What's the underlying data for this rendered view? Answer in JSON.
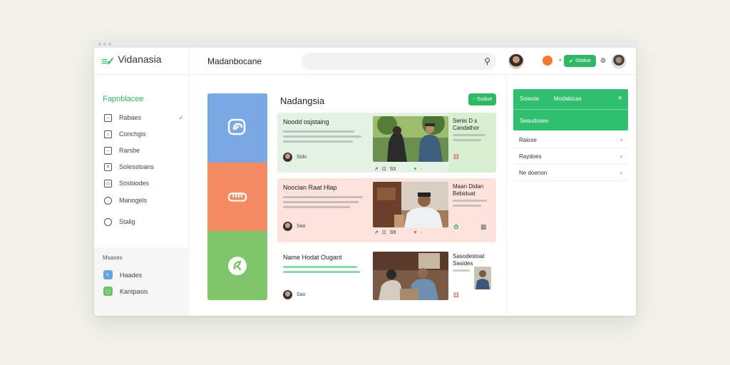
{
  "app": {
    "name": "Vidanasia",
    "tagline": "...........",
    "page_heading": "Madanbocane"
  },
  "topbar": {
    "search_placeholder": "",
    "action_button_label": "Sbidue"
  },
  "sidebar": {
    "title": "Fapnblacee",
    "items": [
      {
        "label": "Rabaes",
        "icon": "square-icon",
        "active": true
      },
      {
        "label": "Conchgis",
        "icon": "square-icon"
      },
      {
        "label": "Rarsbe",
        "icon": "square-icon"
      },
      {
        "label": "Solesstoans",
        "icon": "square-icon"
      },
      {
        "label": "Sosbiodes",
        "icon": "square-icon"
      },
      {
        "label": "Manogels",
        "icon": "clock-icon"
      },
      {
        "label": "Stalig",
        "icon": "circle-icon"
      }
    ],
    "bottom": {
      "title": "Msases",
      "items": [
        {
          "label": "Haades",
          "color": "#6aa3e0"
        },
        {
          "label": "Kantpasis",
          "color": "#6cc069"
        }
      ]
    }
  },
  "rail": [
    {
      "color": "#79a8e3",
      "icon": "chat-icon"
    },
    {
      "color": "#f58b63",
      "icon": "handshake-icon"
    },
    {
      "color": "#7fc66b",
      "icon": "leaf-icon"
    }
  ],
  "feed": {
    "title": "Nadangsia",
    "button_label": "Ssidue",
    "cards": [
      {
        "title": "Noodd osjstaing",
        "author": "Sido",
        "stats": "S3",
        "side_title": "Senis D s Candathor",
        "bg": "#e4f2e6",
        "side_bg": "#d9efd2"
      },
      {
        "title": "Noocian Raat Hlap",
        "author": "Sao",
        "stats": "S9",
        "side_title": "Maan Didan Bebiduat",
        "bg": "#fde3dc",
        "side_bg": "#fde3dc"
      },
      {
        "title": "Name Hodat Ougant",
        "author": "Sao",
        "stats": "",
        "side_title": "Sasodestoat Sasides",
        "bg": "#ffffff",
        "side_bg": "#ffffff"
      }
    ]
  },
  "right_panel": {
    "green": {
      "label_a": "Soieute",
      "label_b": "Modabicas",
      "label_c": "Seaudoses"
    },
    "rows": [
      {
        "label": "Raiose"
      },
      {
        "label": "Raydoes"
      },
      {
        "label": "Ne doenon"
      }
    ]
  },
  "colors": {
    "accent": "#2fb866"
  }
}
